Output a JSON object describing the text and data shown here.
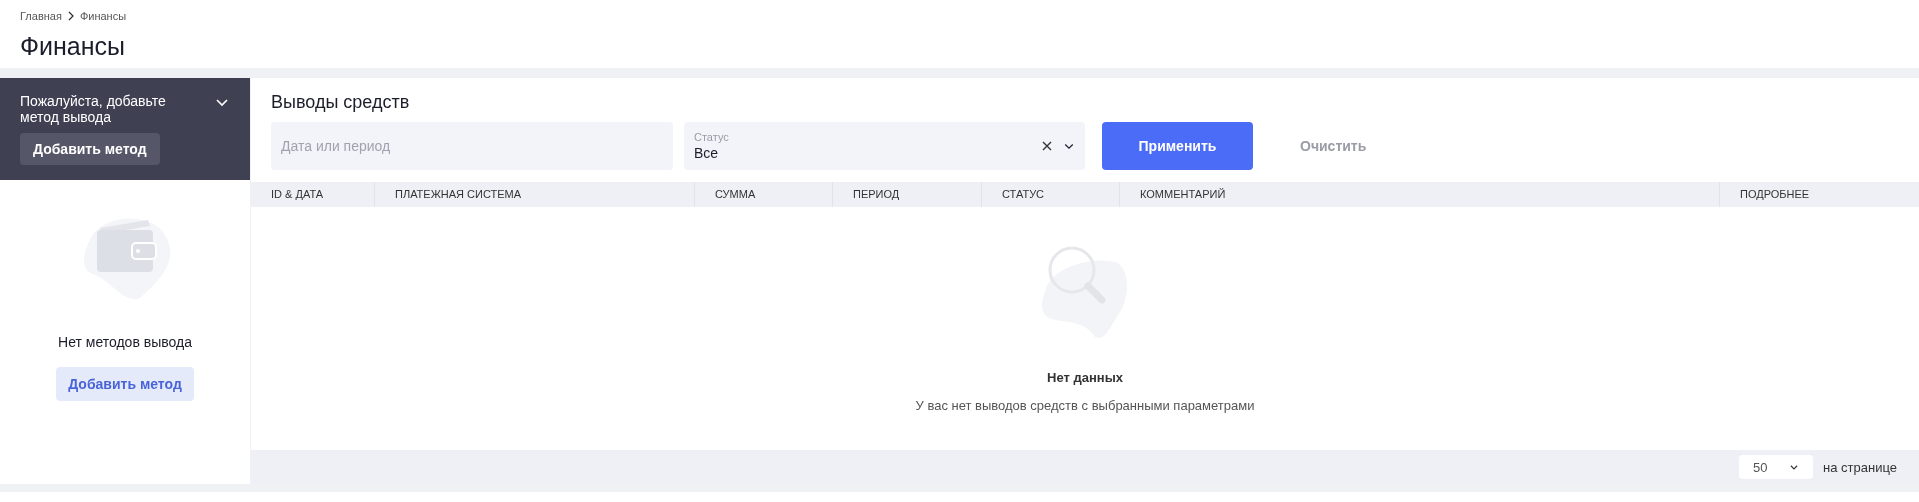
{
  "breadcrumbs": [
    {
      "label": "Главная"
    },
    {
      "label": "Финансы"
    }
  ],
  "page_title": "Финансы",
  "methods_panel": {
    "notice": "Пожалуйста, добавьте метод вывода",
    "expanded": false,
    "notice_button": "Добавить метод",
    "empty_title": "Нет методов вывода",
    "empty_button": "Добавить метод"
  },
  "withdrawals": {
    "title": "Выводы средств",
    "filters": {
      "date": {
        "placeholder": "Дата или период"
      },
      "status": {
        "label": "Статус",
        "value": "Все"
      },
      "apply": "Применить",
      "clear": "Очистить"
    },
    "table": {
      "columns": [
        "ID & ДАТА",
        "ПЛАТЕЖНАЯ СИСТЕМА",
        "СУММА",
        "ПЕРИОД",
        "СТАТУС",
        "КОММЕНТАРИЙ",
        "ПОДРОБНЕЕ"
      ]
    },
    "empty": {
      "title": "Нет данных",
      "text": "У вас нет выводов средств с выбранными параметрами"
    },
    "pagination": {
      "page_size": "50",
      "label": "на странице"
    }
  }
}
